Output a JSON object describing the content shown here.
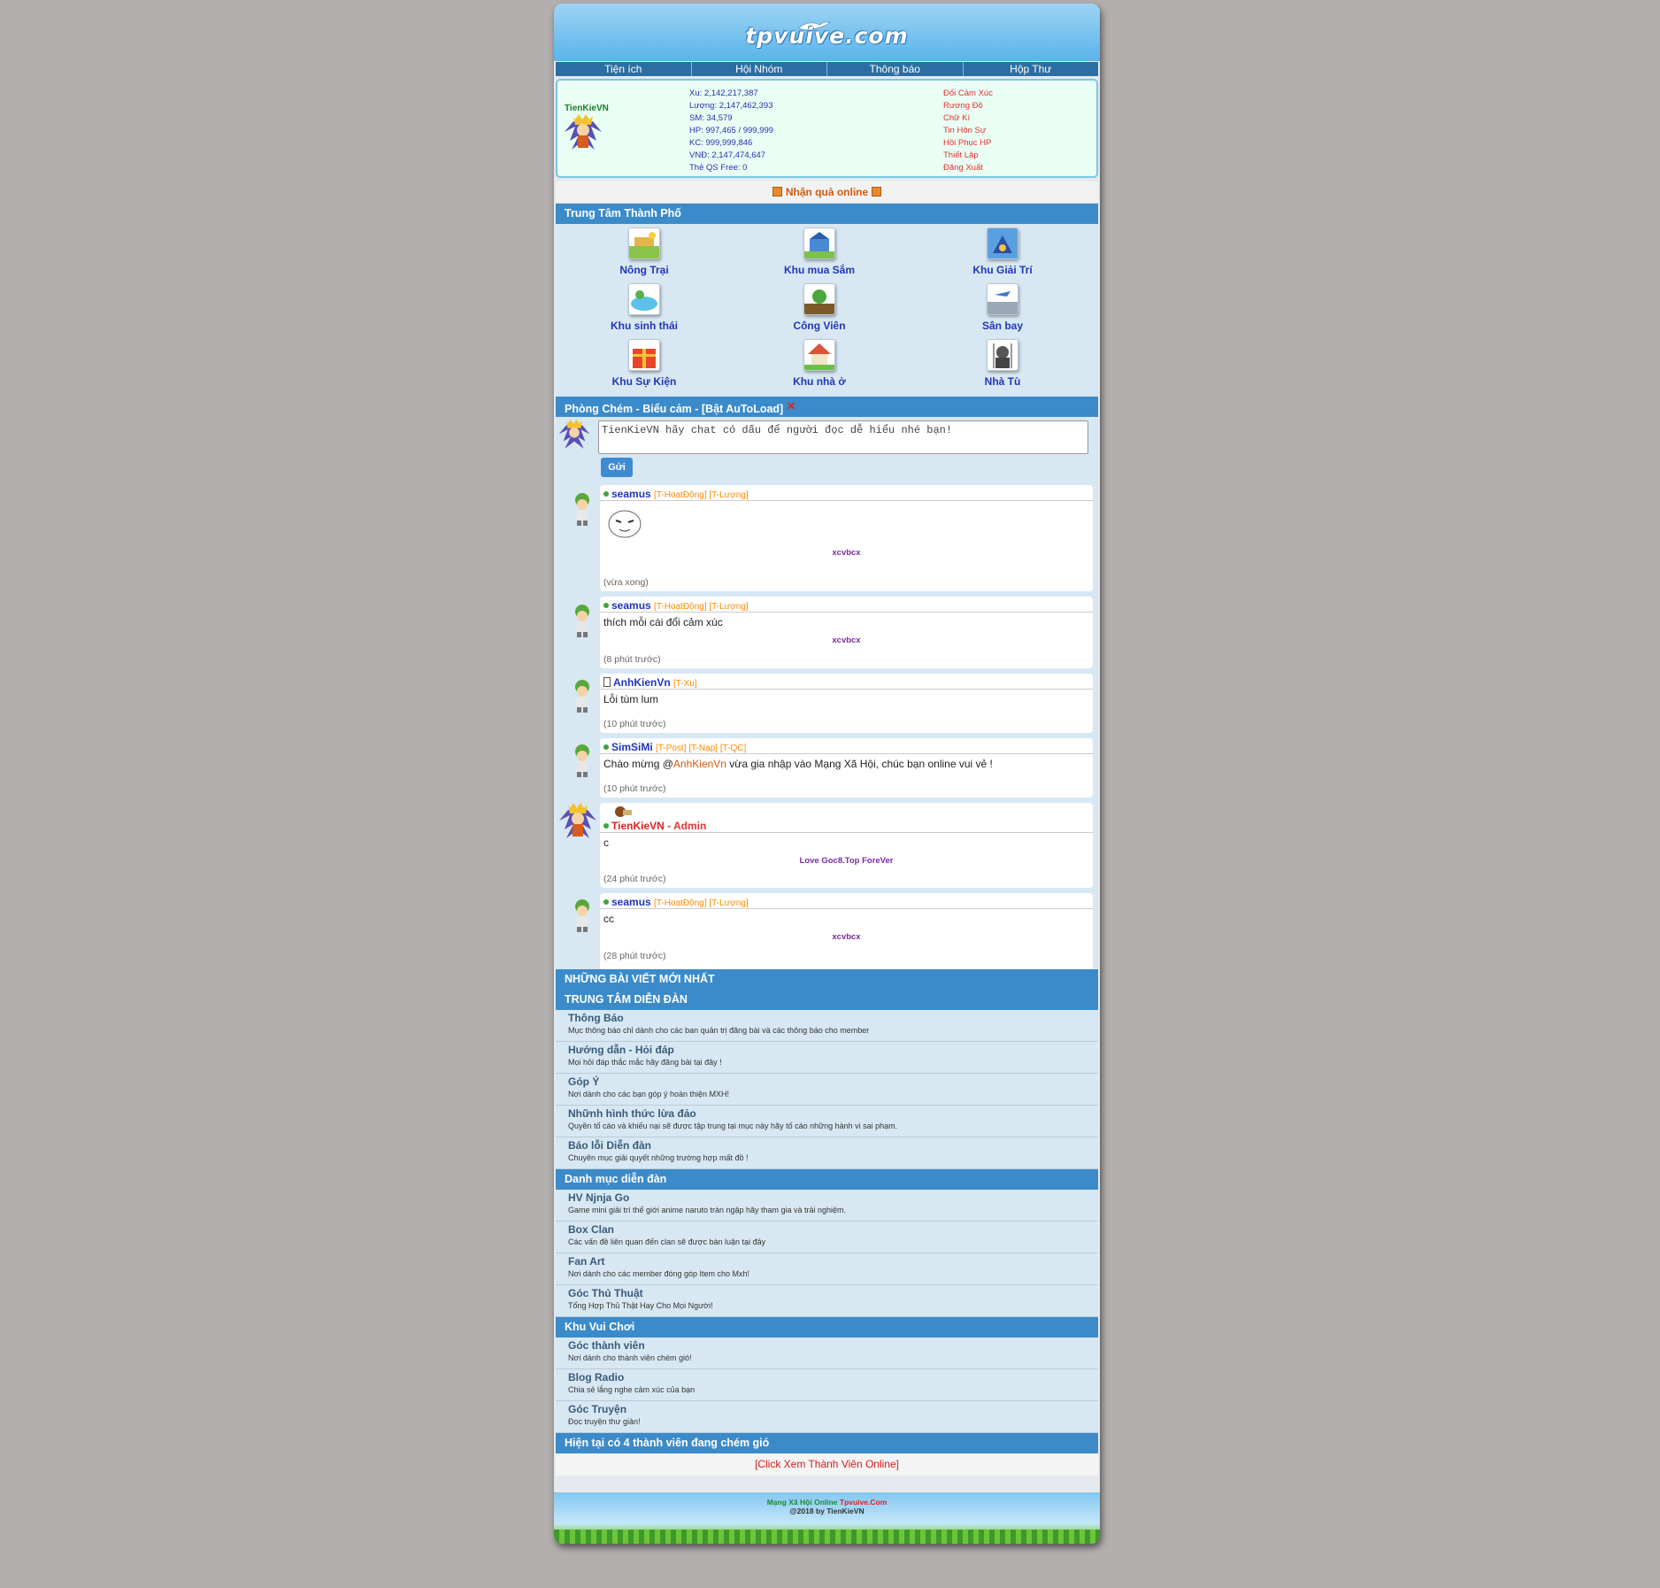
{
  "header": {
    "logo_text": "tpvuive.com"
  },
  "nav": [
    {
      "label": "Tiện ích"
    },
    {
      "label": "Hội Nhóm"
    },
    {
      "label": "Thông báo"
    },
    {
      "label": "Hộp Thư"
    }
  ],
  "profile": {
    "username": "TienKieVN",
    "stats": [
      "Xu: 2,142,217,387",
      "Lượng: 2,147,462,393",
      "SM: 34,579",
      "HP: 997,465 / 999,999",
      "KC: 999,999,846",
      "VNĐ: 2,147,474,647",
      "Thẻ QS Free: 0"
    ],
    "actions": [
      "Đổi Cảm Xúc",
      "Rương Đồ",
      "Chữ Kí",
      "Tin Hôn Sự",
      "Hồi Phục HP",
      "Thiết Lập",
      "Đăng Xuất"
    ]
  },
  "gift": {
    "label": "Nhận quà online"
  },
  "city": {
    "title": "Trung Tâm Thành Phố",
    "items": [
      {
        "label": "Nông Trại",
        "icon": "farm-icon"
      },
      {
        "label": "Khu mua Sắm",
        "icon": "shopping-icon"
      },
      {
        "label": "Khu Giải Trí",
        "icon": "entertainment-icon"
      },
      {
        "label": "Khu sinh thái",
        "icon": "ecology-icon"
      },
      {
        "label": "Công Viên",
        "icon": "park-icon"
      },
      {
        "label": "Sân bay",
        "icon": "airport-icon"
      },
      {
        "label": "Khu Sự Kiện",
        "icon": "gift-box-icon"
      },
      {
        "label": "Khu nhà ở",
        "icon": "house-icon"
      },
      {
        "label": "Nhà Tù",
        "icon": "jail-icon"
      }
    ]
  },
  "chat": {
    "title": "Phòng Chém - Biểu cảm - [Bật AuToLoad]",
    "placeholder": "TienKieVN hãy chat có dấu để người đọc dễ hiểu nhé bạn!",
    "send_label": "Gửi",
    "messages": [
      {
        "user": "seamus",
        "tags": "[T-HoạtĐộng] [T-Lượng]",
        "text": "",
        "sticker": true,
        "signature": "xcvbcx",
        "time": "(vừa xong)"
      },
      {
        "user": "seamus",
        "tags": "[T-HoạtĐộng] [T-Lượng]",
        "text": "thích mỗi cái đổi cảm xúc",
        "signature": "xcvbcx",
        "time": "(8 phút trước)"
      },
      {
        "user": "AnhKienVn",
        "tags": "[T-Xu]",
        "text": "Lỗi tùm lum",
        "signature": "",
        "time": "(10 phút trước)"
      },
      {
        "user": "SimSiMi",
        "tags": "[T-Post] [T-Nạp] [T-QC]",
        "text_before": "Chào mừng @",
        "mention": "AnhKienVn",
        "text_after": " vừa gia nhập vào Mạng Xã Hội, chúc bạn online vui vẻ !",
        "signature": "",
        "time": "(10 phút trước)"
      },
      {
        "user": "TienKieVN",
        "role": " - Admin",
        "text": "c",
        "signature": "Love Goc8.Top ForeVer",
        "time": "(24 phút trước)"
      },
      {
        "user": "seamus",
        "tags": "[T-HoạtĐộng] [T-Lượng]",
        "text": "cc",
        "signature": "xcvbcx",
        "time": "(28 phút trước)"
      }
    ]
  },
  "latest_posts": {
    "title": "NHỮNG BÀI VIẾT MỚI NHẤT"
  },
  "forum_center": {
    "title": "TRUNG TÂM DIỄN ĐÀN",
    "items": [
      {
        "title": "Thông Báo",
        "desc": "Mục thông báo chỉ dành cho các ban quản trị đăng bài và các thông báo cho member"
      },
      {
        "title": "Hướng dẫn - Hỏi đáp",
        "desc": "Mọi hỏi đáp thắc mắc hãy đăng bài tại đây !"
      },
      {
        "title": "Góp Ý",
        "desc": "Nơi dành cho các bạn góp ý hoàn thiện MXH!"
      },
      {
        "title": "Nhữnh hình thức lừa đảo",
        "desc": "Quyền tố cáo và khiếu nại sẽ được tập trung tại mục này hãy tố cáo những hành vi sai phạm."
      },
      {
        "title": "Báo lỗi Diễn đàn",
        "desc": "Chuyên mục giải quyết những trường hợp mất đồ !"
      }
    ]
  },
  "forum_categories": {
    "title": "Danh mục diễn đàn",
    "items": [
      {
        "title": "HV Njnja Go",
        "desc": "Game mini giải trí thế giới anime naruto tràn ngập hãy tham gia và trải nghiệm."
      },
      {
        "title": "Box Clan",
        "desc": "Các vấn đề liên quan đến clan sẽ được bàn luận tại đây"
      },
      {
        "title": "Fan Art",
        "desc": "Nơi dành cho các member đóng góp Item cho Mxh!"
      },
      {
        "title": "Góc Thủ Thuật",
        "desc": "Tổng Hợp Thủ Thật Hay Cho Mọi Người!"
      }
    ]
  },
  "fun_zone": {
    "title": "Khu Vui Chơi",
    "items": [
      {
        "title": "Góc thành viên",
        "desc": "Nơi dành cho thành viên chém gió!"
      },
      {
        "title": "Blog Radio",
        "desc": "Chia sẻ lắng nghe cảm xúc của bạn"
      },
      {
        "title": "Góc Truyện",
        "desc": "Đọc truyện thư giản!"
      }
    ]
  },
  "online": {
    "title": "Hiện tại có 4 thành viên đang chém gió",
    "link": "[Click Xem Thành Viên Online]"
  },
  "footer": {
    "line1_prefix": "Mạng Xã Hội Online ",
    "line1_site": "Tpvuive.Com",
    "line2": "@2018 by TienKieVN"
  },
  "colors": {
    "accent": "#3b8bca",
    "nav": "#2a6ea3",
    "link": "#2036b8",
    "tag": "#ff8a00",
    "alert": "#e02020"
  }
}
